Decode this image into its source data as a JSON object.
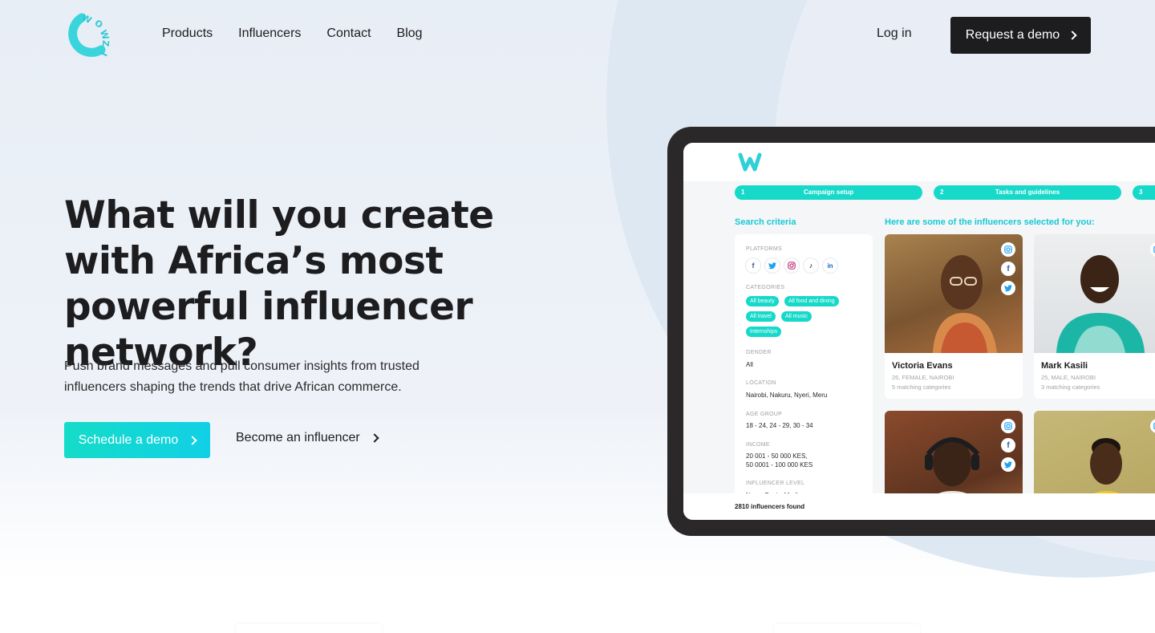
{
  "nav": {
    "logo_text": "WOWZI",
    "links": [
      "Products",
      "Influencers",
      "Contact",
      "Blog"
    ],
    "login": "Log in",
    "request_demo": "Request a demo"
  },
  "hero": {
    "headline": "What will you create with Africa’s most powerful influencer network?",
    "subtext": "Push brand messages and pull consumer insights from trusted influencers shaping the trends that drive African commerce.",
    "cta_primary": "Schedule a demo",
    "cta_secondary": "Become an influencer"
  },
  "app": {
    "steps": [
      {
        "num": "1",
        "label": "Campaign setup"
      },
      {
        "num": "2",
        "label": "Tasks and guidelines"
      },
      {
        "num": "3",
        "label": ""
      }
    ],
    "search_title": "Search criteria",
    "results_title": "Here are some of the influencers selected for you:",
    "criteria": {
      "platforms_label": "PLATFORMS",
      "platform_icons": [
        "facebook-icon",
        "twitter-icon",
        "instagram-icon",
        "tiktok-icon",
        "linkedin-icon"
      ],
      "categories_label": "CATEGORIES",
      "categories": [
        "All beauty",
        "All food and dining",
        "All travel",
        "All music",
        "Internships"
      ],
      "gender_label": "GENDER",
      "gender": "All",
      "location_label": "LOCATION",
      "location": "Nairobi, Nakuru, Nyeri, Meru",
      "age_label": "AGE GROUP",
      "age": "18 - 24, 24 - 29, 30 - 34",
      "income_label": "INCOME",
      "income_1": "20 001 - 50 000 KES,",
      "income_2": "50 0001 - 100 000 KES",
      "level_label": "INFLUENCER LEVEL",
      "level": "Nano, Basic, Medium"
    },
    "influencers": [
      {
        "name": "Victoria Evans",
        "details": "26, FEMALE, NAIROBI",
        "matching": "5 matching categories"
      },
      {
        "name": "Mark Kasili",
        "details": "25, MALE, NAIROBI",
        "matching": "3 matching categories"
      }
    ],
    "found": "2810 influencers found"
  },
  "colors": {
    "accent": "#16d9c9",
    "dark": "#1d1d1f",
    "hero_bg": "#e8eef6"
  }
}
